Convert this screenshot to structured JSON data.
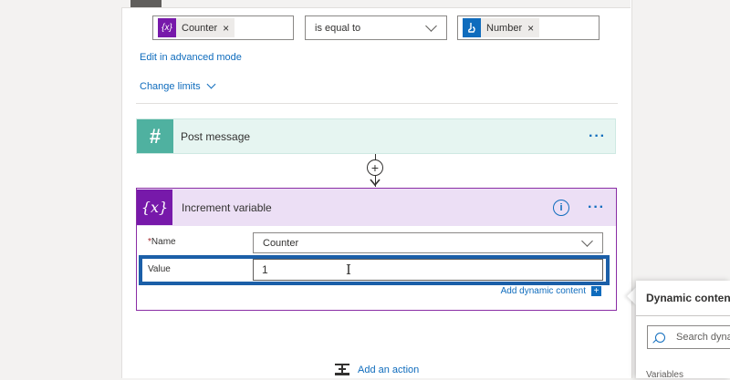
{
  "condition": {
    "left_token": {
      "icon": "variable-icon",
      "icon_glyph": "{x}",
      "label": "Counter",
      "remove": "×"
    },
    "operator": "is equal to",
    "right_token": {
      "icon": "manual-trigger-icon",
      "label": "Number",
      "remove": "×"
    },
    "edit_advanced": "Edit in advanced mode",
    "change_limits": "Change limits"
  },
  "post_message": {
    "title": "Post message",
    "icon": "slack-icon",
    "icon_glyph": "#",
    "more": "···",
    "color": "#4fb1a0"
  },
  "connector": {
    "plus": "+"
  },
  "increment": {
    "title": "Increment variable",
    "icon_glyph": "{x}",
    "info": "i",
    "more": "···",
    "name_label": "Name",
    "required_mark": "*",
    "name_value": "Counter",
    "value_label": "Value",
    "value_value": "1",
    "add_dynamic": "Add dynamic content",
    "add_dynamic_plus": "+",
    "accent": "#7719aa"
  },
  "dynamic_panel": {
    "title": "Dynamic content",
    "search_placeholder": "Search dynamic content",
    "section": "Variables"
  },
  "add_action": {
    "label": "Add an action"
  }
}
